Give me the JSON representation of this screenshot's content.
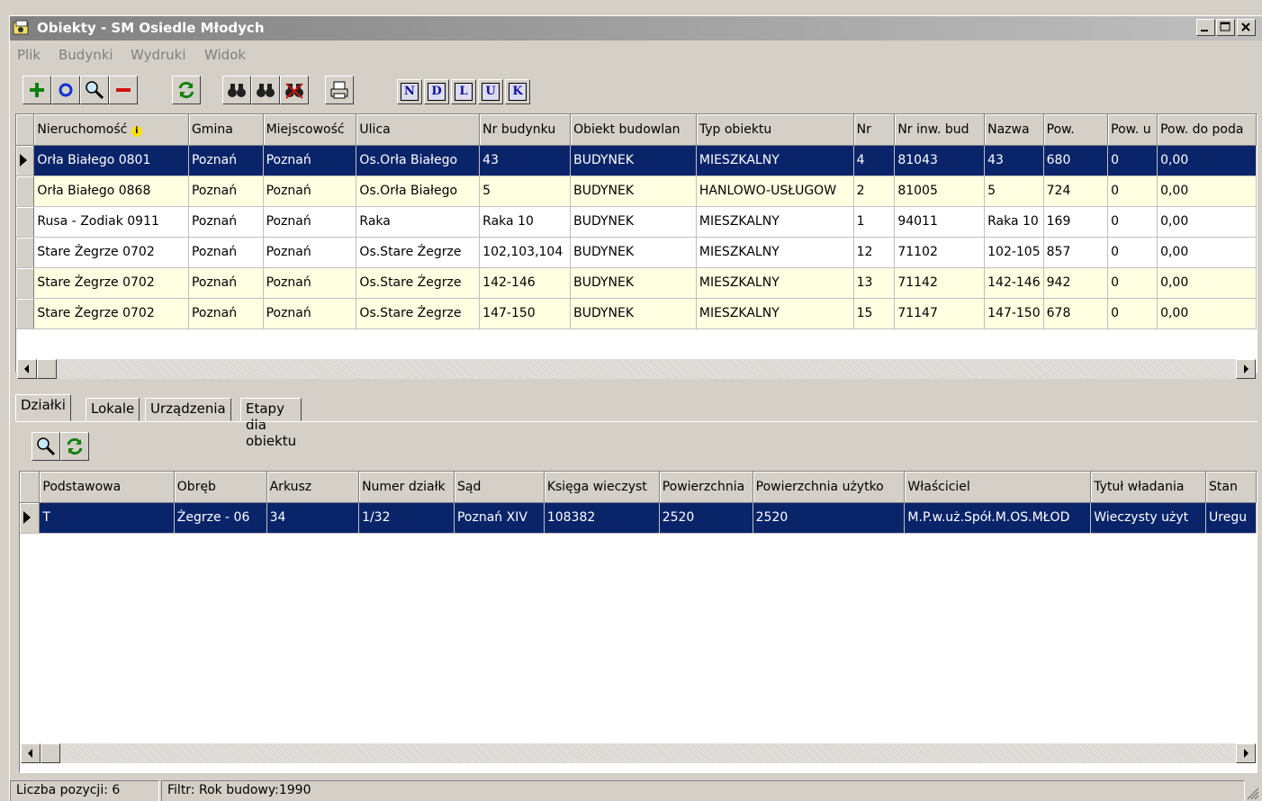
{
  "window": {
    "title": "Obiekty - SM Osiedle Młodych"
  },
  "menu": [
    "Plik",
    "Budynki",
    "Wydruki",
    "Widok"
  ],
  "toolbar": {
    "letters": [
      "N",
      "D",
      "L",
      "U",
      "K"
    ]
  },
  "main_grid": {
    "columns": [
      "Nieruchomość",
      "Gmina",
      "Miejscowość",
      "Ulica",
      "Nr budynku",
      "Obiekt budowlan",
      "Typ obiektu",
      "Nr",
      "Nr inw. bud",
      "Nazwa",
      "Pow.",
      "Pow. u",
      "Pow. do poda"
    ],
    "rows": [
      [
        "Orła Białego 0801",
        "Poznań",
        "Poznań",
        "Os.Orła Białego",
        "43",
        "BUDYNEK",
        "MIESZKALNY",
        "4",
        "81043",
        "43",
        "680",
        "0",
        "0,00"
      ],
      [
        "Orła Białego 0868",
        "Poznań",
        "Poznań",
        "Os.Orła Białego",
        "5",
        "BUDYNEK",
        "HANLOWO-USŁUGOW",
        "2",
        "81005",
        "5",
        "724",
        "0",
        "0,00"
      ],
      [
        "Rusa - Zodiak 0911",
        "Poznań",
        "Poznań",
        "Raka",
        "Raka 10",
        "BUDYNEK",
        "MIESZKALNY",
        "1",
        "94011",
        "Raka 10",
        "169",
        "0",
        "0,00"
      ],
      [
        "Stare Żegrze 0702",
        "Poznań",
        "Poznań",
        "Os.Stare Żegrze",
        "102,103,104",
        "BUDYNEK",
        "MIESZKALNY",
        "12",
        "71102",
        "102-105",
        "857",
        "0",
        "0,00"
      ],
      [
        "Stare Żegrze 0702",
        "Poznań",
        "Poznań",
        "Os.Stare Żegrze",
        "142-146",
        "BUDYNEK",
        "MIESZKALNY",
        "13",
        "71142",
        "142-146",
        "942",
        "0",
        "0,00"
      ],
      [
        "Stare Żegrze 0702",
        "Poznań",
        "Poznań",
        "Os.Stare Żegrze",
        "147-150",
        "BUDYNEK",
        "MIESZKALNY",
        "15",
        "71147",
        "147-150",
        "678",
        "0",
        "0,00"
      ]
    ]
  },
  "tabs": [
    "Działki",
    "Lokale",
    "Urządzenia",
    "Etapy dla obiektu"
  ],
  "detail_grid": {
    "columns": [
      "Podstawowa",
      "Obręb",
      "Arkusz",
      "Numer działk",
      "Sąd",
      "Księga wieczyst",
      "Powierzchnia",
      "Powierzchnia użytko",
      "Właściciel",
      "Tytuł władania",
      "Stan"
    ],
    "rows": [
      [
        "T",
        "Żegrze - 06",
        "34",
        "1/32",
        "Poznań XIV",
        "108382",
        "2520",
        "2520",
        "M.P.w.uż.Spół.M.OS.MŁOD",
        "Wieczysty użyt",
        "Uregu"
      ]
    ]
  },
  "status": {
    "count": "Liczba pozycji: 6",
    "filter": "Filtr: Rok budowy:1990"
  }
}
